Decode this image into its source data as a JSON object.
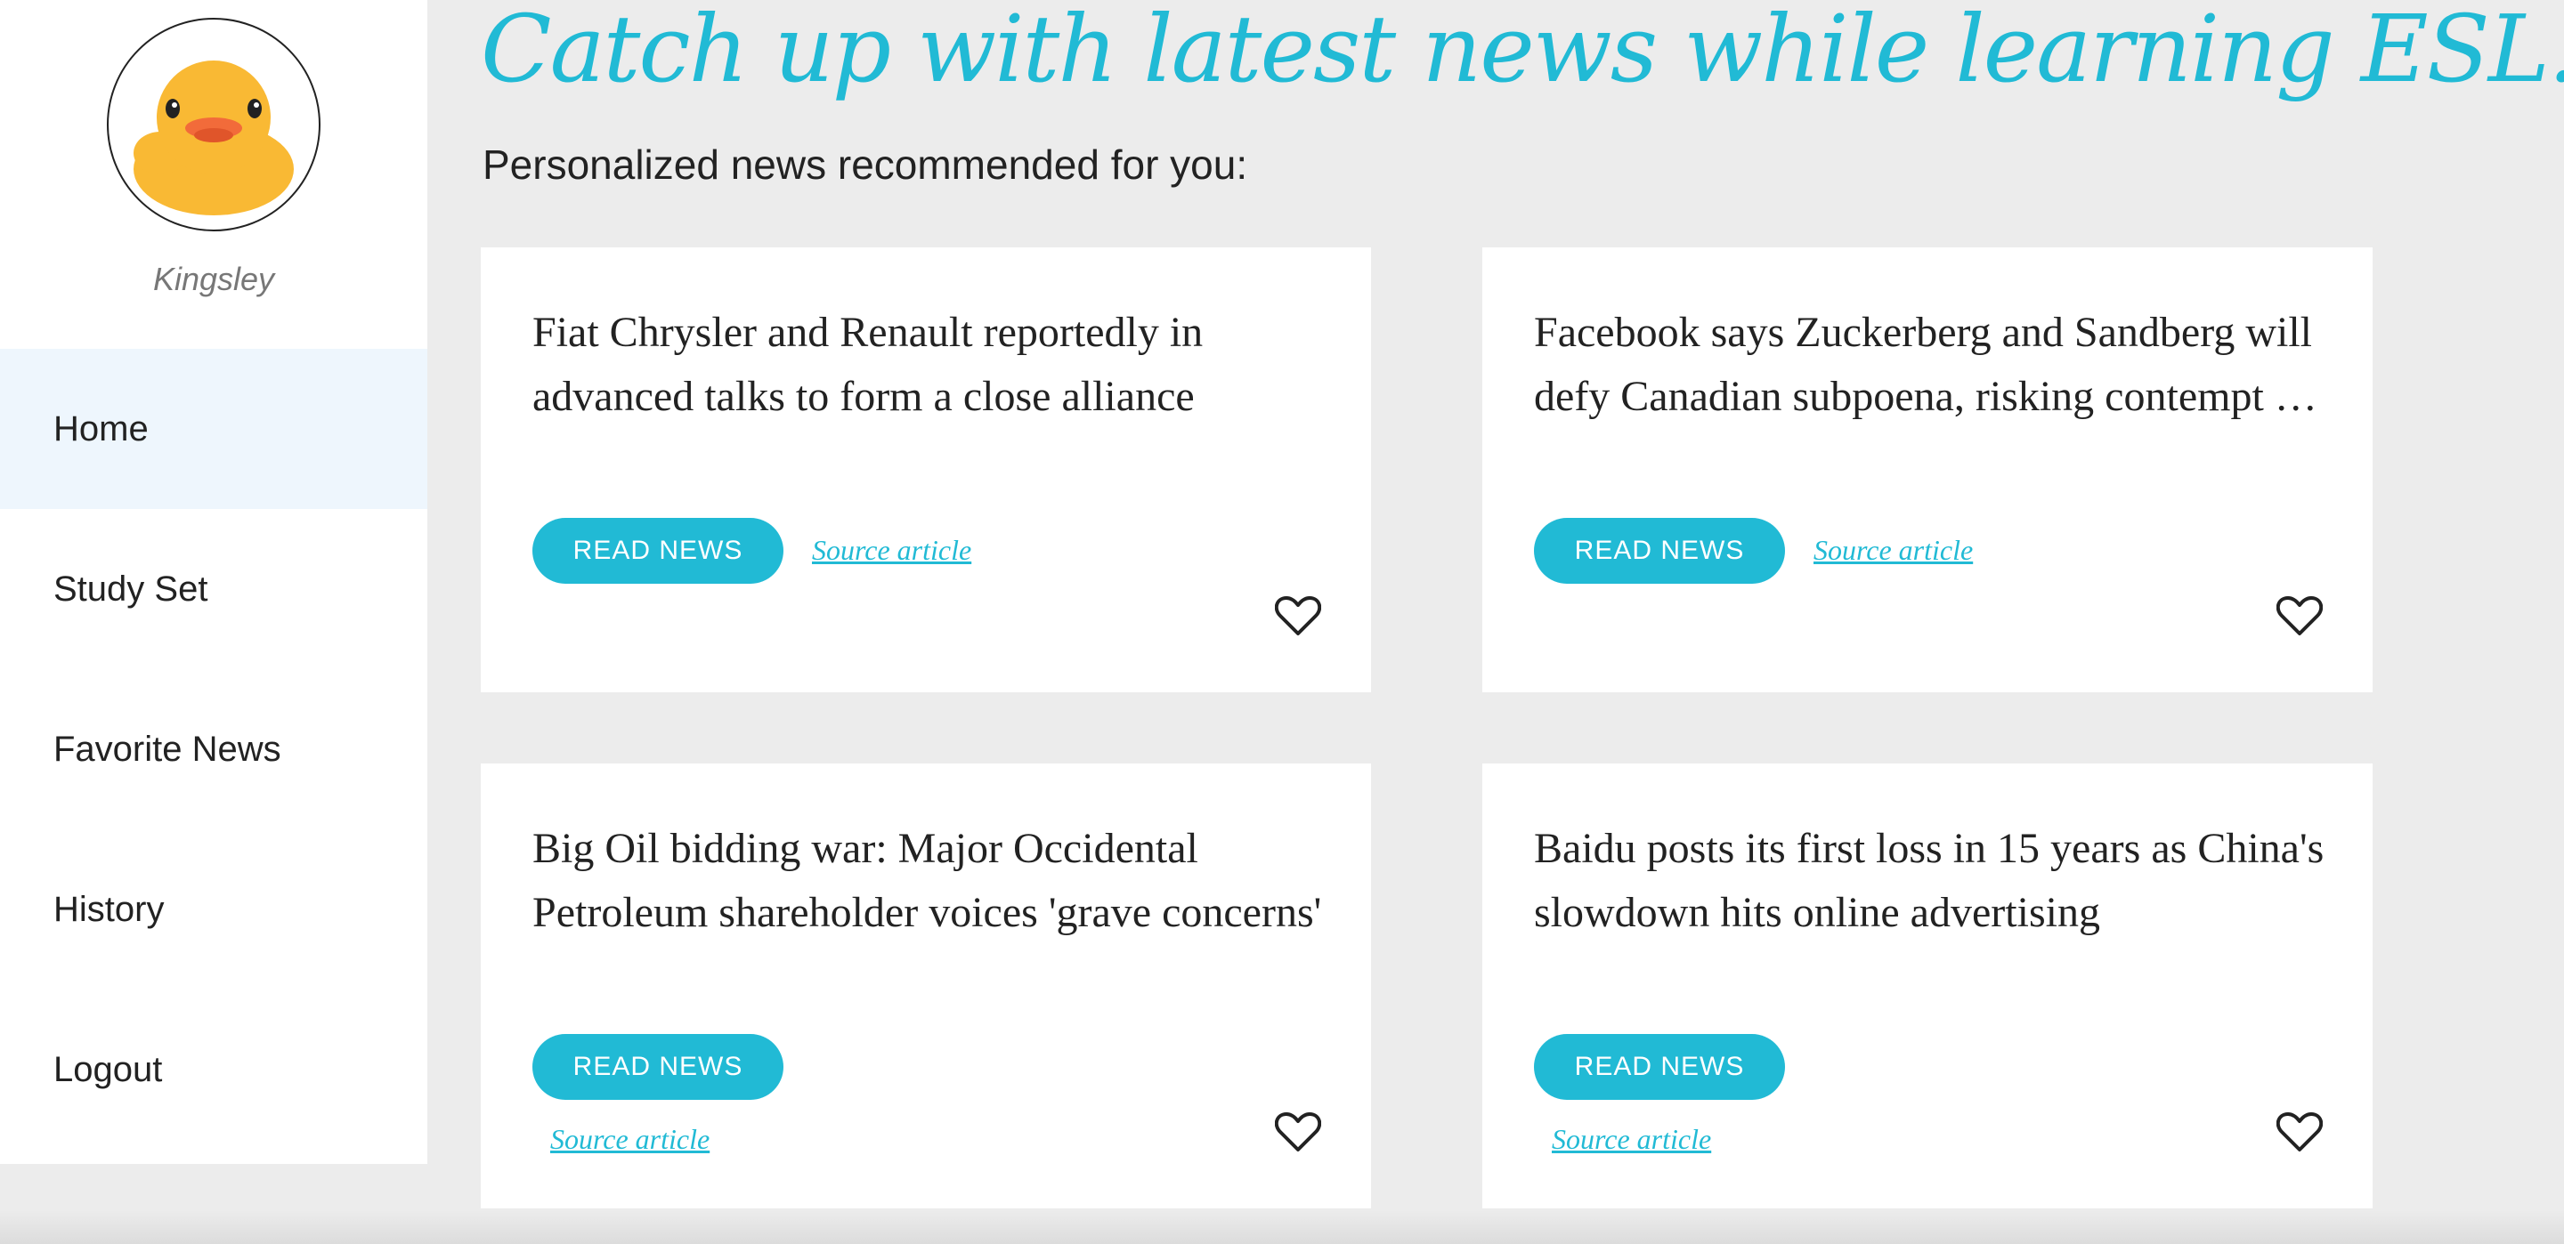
{
  "profile": {
    "name": "Kingsley",
    "avatar_icon": "rubber-duck-icon"
  },
  "nav": {
    "items": [
      {
        "label": "Home",
        "active": true
      },
      {
        "label": "Study Set"
      },
      {
        "label": "Favorite News"
      },
      {
        "label": "History"
      },
      {
        "label": "Logout"
      }
    ]
  },
  "header": {
    "title": "Catch up with latest news while learning ESL...",
    "subtitle": "Personalized news recommended for you:"
  },
  "cards": [
    {
      "title": "Fiat Chrysler and Renault reportedly in advanced talks to form a close alliance",
      "button": "READ NEWS",
      "source": "Source article"
    },
    {
      "title": "Facebook says Zuckerberg and Sandberg will defy Canadian subpoena, risking contempt of parliament",
      "button": "READ NEWS",
      "source": "Source article"
    },
    {
      "title": "Big Oil bidding war: Major Occidental Petroleum shareholder voices 'grave concerns'",
      "button": "READ NEWS",
      "source": "Source article"
    },
    {
      "title": "Baidu posts its first loss in 15 years as China's slowdown hits online advertising",
      "button": "READ NEWS",
      "source": "Source article"
    }
  ],
  "colors": {
    "accent": "#21bad5",
    "background": "#ececec",
    "active_nav": "#eef6fd"
  }
}
